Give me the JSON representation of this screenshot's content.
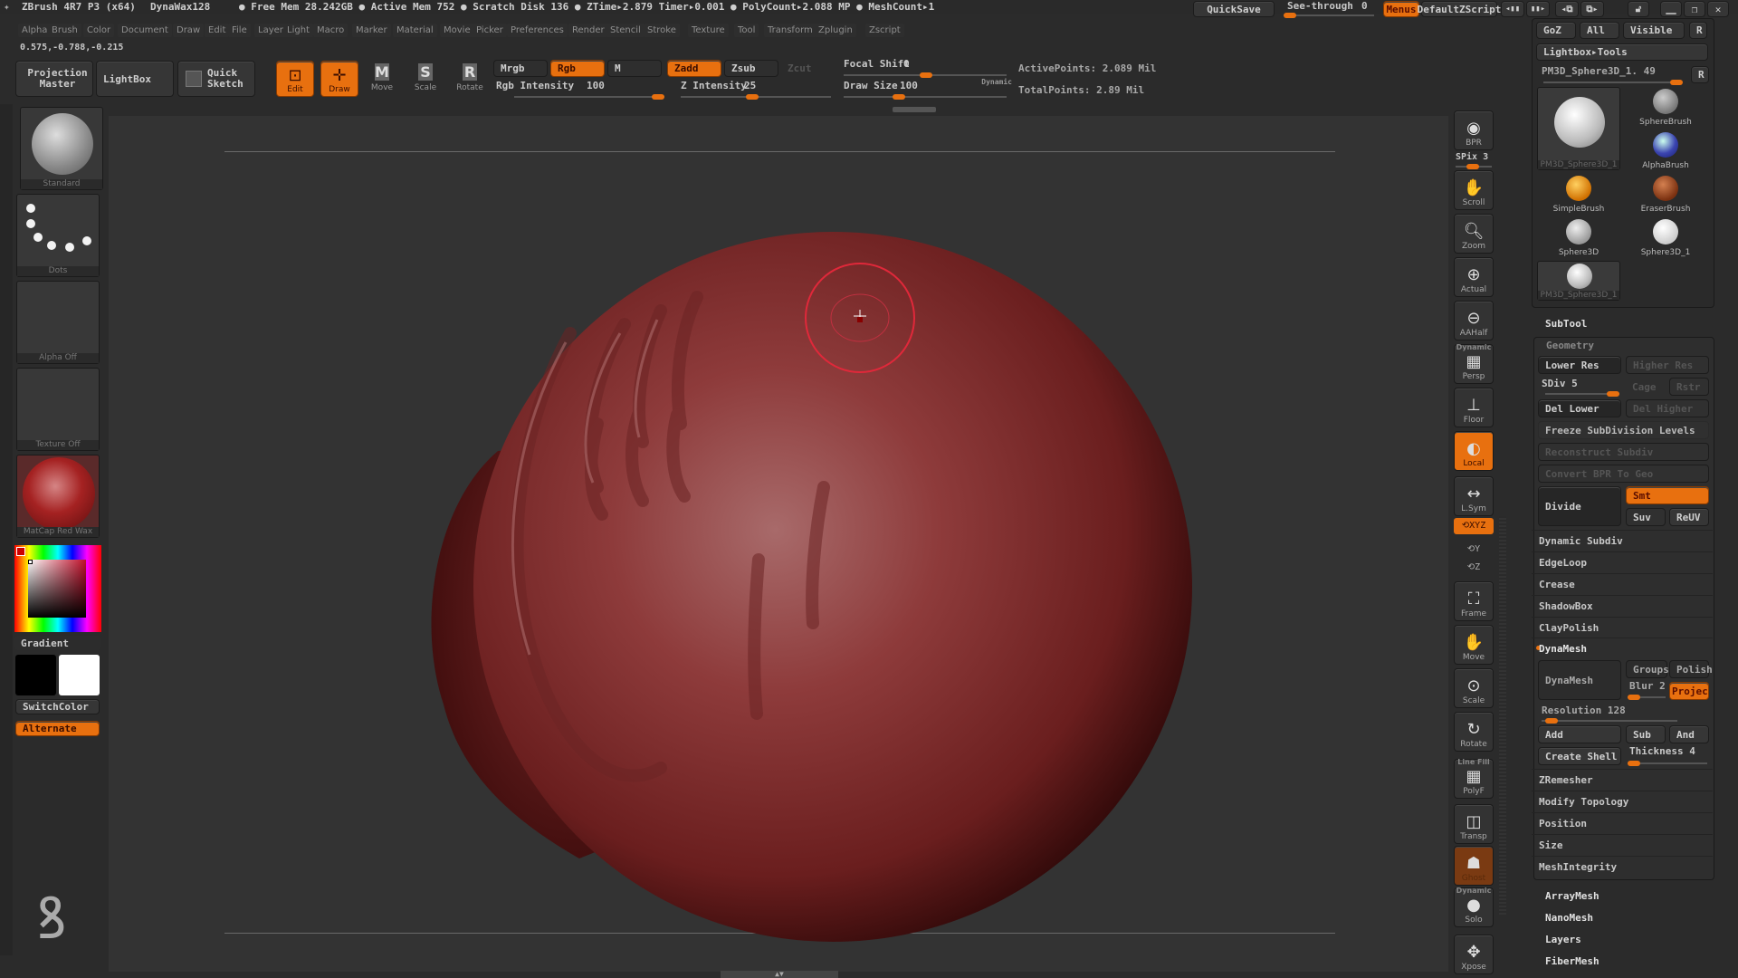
{
  "titlebar": {
    "app": "ZBrush 4R7 P3 (x64)",
    "document": "DynaWax128",
    "stats": "● Free Mem 28.242GB ● Active Mem 752 ● Scratch Disk 136 ● ZTime▸2.879 Timer▸0.001 ● PolyCount▸2.088 MP ● MeshCount▸1",
    "quicksave": "QuickSave",
    "see_through_label": "See-through",
    "see_through_value": "0",
    "menus": "Menus",
    "default_zscript": "DefaultZScript"
  },
  "menubar": [
    "Alpha",
    "Brush",
    "Color",
    "Document",
    "Draw",
    "Edit",
    "File",
    "Layer",
    "Light",
    "Macro",
    "Marker",
    "Material",
    "Movie",
    "Picker",
    "Preferences",
    "Render",
    "Stencil",
    "Stroke",
    "Texture",
    "Tool",
    "Transform",
    "Zplugin",
    "Zscript"
  ],
  "coords": "0.575,-0.788,-0.215",
  "toolbar": {
    "projection_master": "Projection Master",
    "lightbox": "LightBox",
    "quick_sketch": "Quick Sketch",
    "edit": "Edit",
    "draw": "Draw",
    "move": "Move",
    "scale": "Scale",
    "rotate": "Rotate",
    "mrgb": "Mrgb",
    "rgb": "Rgb",
    "m": "M",
    "zadd": "Zadd",
    "zsub": "Zsub",
    "zcut": "Zcut",
    "rgb_intensity_label": "Rgb Intensity",
    "rgb_intensity_value": "100",
    "z_intensity_label": "Z Intensity",
    "z_intensity_value": "25",
    "focal_shift_label": "Focal Shift",
    "focal_shift_value": "0",
    "draw_size_label": "Draw Size",
    "draw_size_value": "100",
    "dynamic": "Dynamic",
    "active_points": "ActivePoints: 2.089 Mil",
    "total_points": "TotalPoints: 2.89 Mil"
  },
  "left_shelf": {
    "brush": "Standard",
    "stroke": "Dots",
    "alpha": "Alpha Off",
    "texture": "Texture Off",
    "material": "MatCap Red Wax",
    "gradient": "Gradient",
    "switch_color": "SwitchColor",
    "alternate": "Alternate",
    "main_color": "#000000",
    "secondary_color": "#ffffff"
  },
  "right_shelf": [
    {
      "label": "BPR",
      "icon": "bpr-icon"
    },
    {
      "label": "SPix 3",
      "icon": "spix-slider"
    },
    {
      "label": "Scroll",
      "icon": "hand-icon"
    },
    {
      "label": "Zoom",
      "icon": "magnifier-icon"
    },
    {
      "label": "Actual",
      "icon": "actual-icon"
    },
    {
      "label": "AAHalf",
      "icon": "aahalf-icon"
    },
    {
      "label": "Persp",
      "icon": "perspective-icon",
      "top": "Dynamic"
    },
    {
      "label": "Floor",
      "icon": "floor-icon"
    },
    {
      "label": "Local",
      "icon": "local-icon",
      "active": true
    },
    {
      "label": "L.Sym",
      "icon": "symmetry-icon"
    },
    {
      "label": "XYZ",
      "icon": "xyz-rotate-icon",
      "active": true
    },
    {
      "label": "Y",
      "icon": "y-rotate-icon"
    },
    {
      "label": "Z",
      "icon": "z-rotate-icon"
    },
    {
      "label": "Frame",
      "icon": "frame-icon"
    },
    {
      "label": "Move",
      "icon": "move-icon"
    },
    {
      "label": "Scale",
      "icon": "scale-icon"
    },
    {
      "label": "Rotate",
      "icon": "rotate-icon"
    },
    {
      "label": "PolyF",
      "icon": "polyframe-icon",
      "top": "Line Fill"
    },
    {
      "label": "Transp",
      "icon": "transparency-icon"
    },
    {
      "label": "Ghost",
      "icon": "ghost-icon"
    },
    {
      "label": "Solo",
      "icon": "solo-icon",
      "top": "Dynamic"
    },
    {
      "label": "Xpose",
      "icon": "xpose-icon"
    }
  ],
  "tool_panel": {
    "goz": "GoZ",
    "all": "All",
    "visible": "Visible",
    "r": "R",
    "lightbox_tools": "Lightbox▸Tools",
    "current_tool": "PM3D_Sphere3D_1. 49",
    "tools": [
      {
        "name": "PM3D_Sphere3D_1",
        "selected": true
      },
      {
        "name": "SphereBrush"
      },
      {
        "name": "AlphaBrush"
      },
      {
        "name": "SimpleBrush"
      },
      {
        "name": "EraserBrush"
      },
      {
        "name": "Sphere3D"
      },
      {
        "name": "Sphere3D_1"
      },
      {
        "name": "PM3D_Sphere3D_1"
      }
    ],
    "subtool": "SubTool",
    "geometry": "Geometry",
    "lower_res": "Lower Res",
    "higher_res": "Higher Res",
    "sdiv": "SDiv 5",
    "cage": "Cage",
    "rstr": "Rstr",
    "del_lower": "Del Lower",
    "del_higher": "Del Higher",
    "freeze": "Freeze SubDivision Levels",
    "reconstruct": "Reconstruct Subdiv",
    "convert_bpr": "Convert BPR To Geo",
    "divide": "Divide",
    "smt": "Smt",
    "suv": "Suv",
    "reuv": "ReUV",
    "sections": [
      "Dynamic Subdiv",
      "EdgeLoop",
      "Crease",
      "ShadowBox",
      "ClayPolish"
    ],
    "dynamesh_section": "DynaMesh",
    "dynamesh_btn": "DynaMesh",
    "groups": "Groups",
    "polish": "Polish",
    "blur": "Blur 2",
    "project": "Project",
    "resolution": "Resolution 128",
    "add": "Add",
    "sub": "Sub",
    "and": "And",
    "create_shell": "Create Shell",
    "thickness": "Thickness 4",
    "sections2": [
      "ZRemesher",
      "Modify Topology",
      "Position",
      "Size",
      "MeshIntegrity"
    ],
    "subpalettes": [
      "ArrayMesh",
      "NanoMesh",
      "Layers",
      "FiberMesh"
    ]
  },
  "colors": {
    "accent": "#e8700f",
    "bg": "#2b2b2b",
    "canvas": "#333333",
    "mesh": "#8c3434"
  }
}
